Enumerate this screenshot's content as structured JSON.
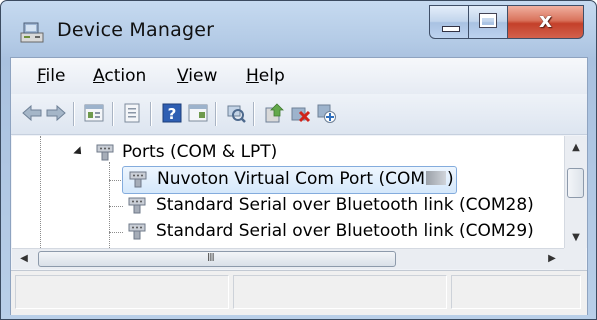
{
  "window": {
    "title": "Device Manager",
    "close_glyph": "x"
  },
  "menu": {
    "items": [
      {
        "label": "File",
        "accel": "F",
        "rest": "ile"
      },
      {
        "label": "Action",
        "accel": "A",
        "rest": "ction"
      },
      {
        "label": "View",
        "accel": "V",
        "rest": "iew"
      },
      {
        "label": "Help",
        "accel": "H",
        "rest": "elp"
      }
    ]
  },
  "toolbar": {
    "icons": [
      "back-arrow-icon",
      "forward-arrow-icon",
      "properties-grid-icon",
      "document-icon",
      "help-icon",
      "console-icon",
      "scan-hardware-icon",
      "update-driver-icon",
      "uninstall-icon",
      "add-legacy-icon"
    ]
  },
  "tree": {
    "category": "Ports (COM & LPT)",
    "devices": [
      {
        "label": "Nuvoton Virtual Com Port (COM",
        "suffix": ")",
        "selected": true
      },
      {
        "label": "Standard Serial over Bluetooth link (COM28)",
        "selected": false
      },
      {
        "label": "Standard Serial over Bluetooth link (COM29)",
        "selected": false
      }
    ]
  },
  "scroll": {
    "h_grip": "III"
  },
  "colors": {
    "selection_border": "#84acdd",
    "close_button": "#c4402a",
    "frame": "#b4cbe6"
  }
}
